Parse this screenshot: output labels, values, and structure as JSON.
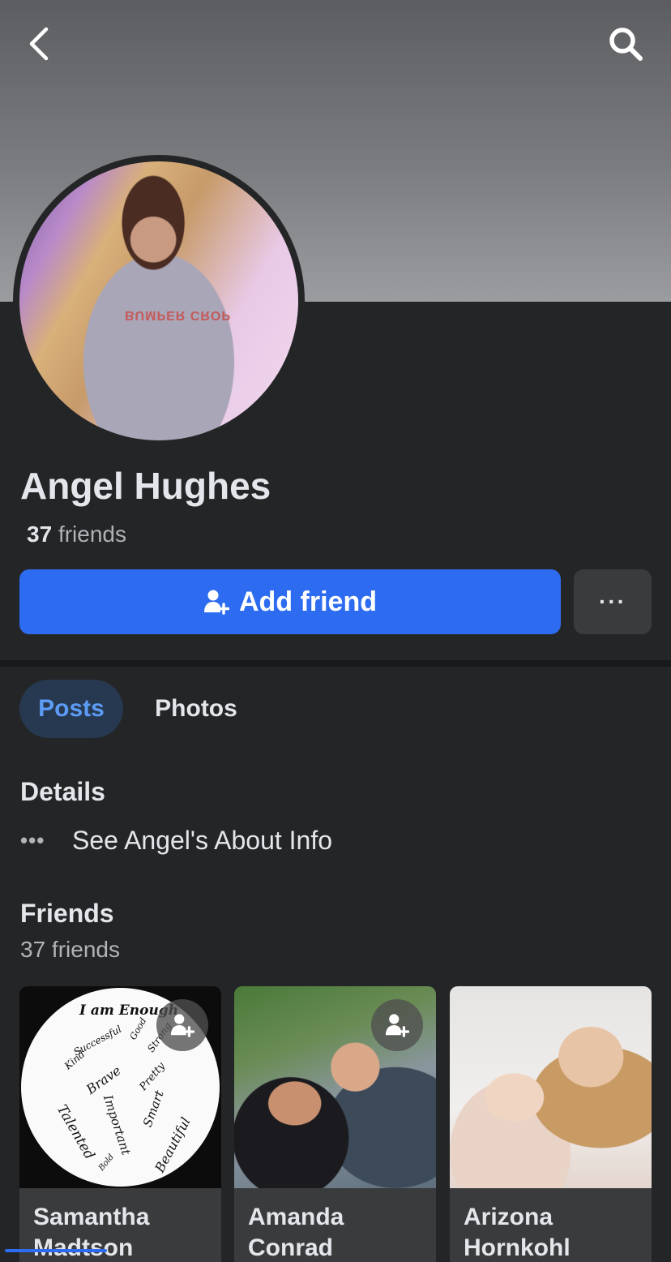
{
  "profile": {
    "name": "Angel Hughes",
    "friend_count": "37",
    "friend_word": "friends"
  },
  "actions": {
    "add_friend_label": "Add friend",
    "more_label": "···"
  },
  "tabs": [
    {
      "label": "Posts",
      "active": true
    },
    {
      "label": "Photos",
      "active": false
    }
  ],
  "details": {
    "title": "Details",
    "about_link": "See Angel's About Info"
  },
  "friends": {
    "title": "Friends",
    "subtitle": "37 friends",
    "cards": [
      {
        "name_line1": "Samantha",
        "name_line2": "Madtson"
      },
      {
        "name_line1": "Amanda",
        "name_line2": "Conrad"
      },
      {
        "name_line1": "Arizona",
        "name_line2": "Hornkohl"
      }
    ]
  },
  "photo_text": {
    "sweater": "BUMPER CROP",
    "art_title": "I am Enough",
    "art_words": [
      "Successful",
      "Good",
      "Strong",
      "Kind",
      "Brave",
      "Pretty",
      "Talented",
      "Important",
      "Smart",
      "Beautiful",
      "Bold"
    ]
  },
  "colors": {
    "background": "#242526",
    "primary_button": "#2d6cf0",
    "active_tab_bg": "#263951",
    "active_tab_text": "#5d9cf5"
  },
  "icons": [
    "back-icon",
    "search-icon",
    "add-person-icon",
    "more-icon"
  ]
}
